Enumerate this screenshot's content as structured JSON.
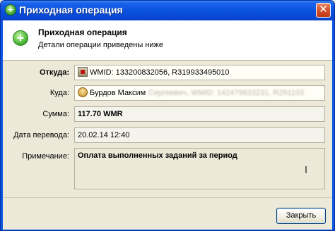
{
  "window": {
    "title": "Приходная операция",
    "close_glyph": "✕"
  },
  "header": {
    "title": "Приходная операция",
    "subtitle": "Детали операции приведены ниже",
    "icon": "plus-circle-icon"
  },
  "form": {
    "from": {
      "label": "Откуда:",
      "value": "WMID: 133200832056, R319933495010",
      "icon": "wallet-icon"
    },
    "to": {
      "label": "Куда:",
      "name": "Бурдов Максим",
      "redacted": "Сергеевич, WMID: 142479833231, R291103",
      "icon": "user-icon"
    },
    "amount": {
      "label": "Сумма:",
      "value": "117.70 WMR"
    },
    "date": {
      "label": "Дата перевода:",
      "value": "20.02.14 12:40"
    },
    "note": {
      "label": "Примечание:",
      "value": "Оплата выполненных заданий за период"
    }
  },
  "footer": {
    "close_label": "Закрыть"
  }
}
